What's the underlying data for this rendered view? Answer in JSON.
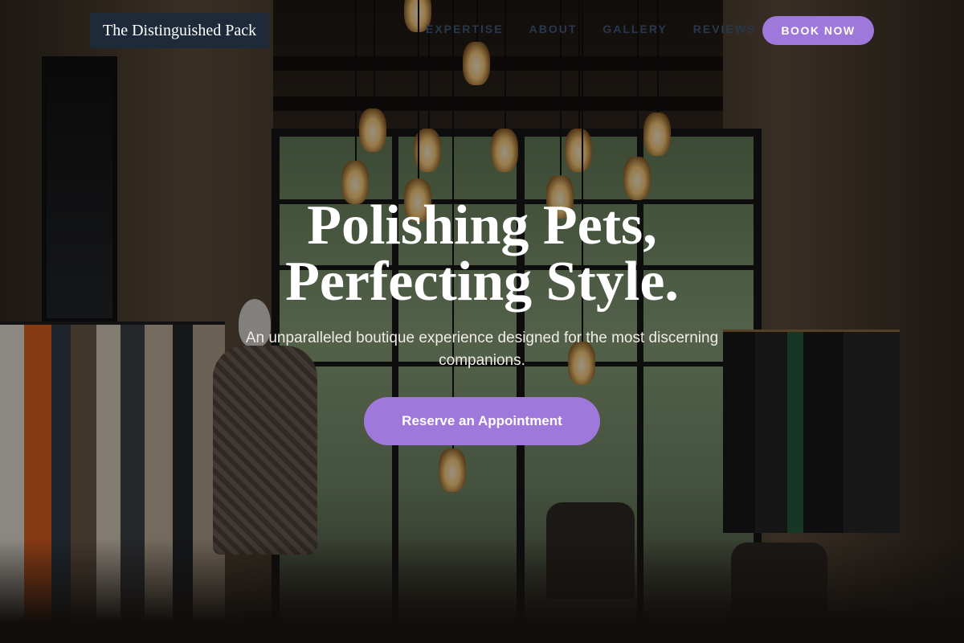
{
  "header": {
    "brand": "The Distinguished Pack",
    "nav": [
      "EXPERTISE",
      "ABOUT",
      "GALLERY",
      "REVIEWS"
    ],
    "book_button": "BOOK NOW"
  },
  "hero": {
    "title_line1": "Polishing Pets,",
    "title_line2": "Perfecting Style.",
    "subtitle": "An unparalleled boutique experience designed for the most discerning companions.",
    "cta": "Reserve an Appointment"
  },
  "colors": {
    "accent": "#9f78dc",
    "brand_bg": "#1e2a3a",
    "nav_text": "#28384d"
  }
}
